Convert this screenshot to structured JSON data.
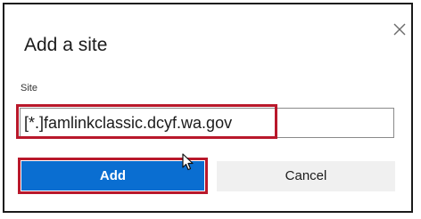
{
  "dialog": {
    "title": "Add a site",
    "close_icon": "close-icon",
    "site_label": "Site",
    "site_value": "[*.]famlinkclassic.dcyf.wa.gov",
    "add_label": "Add",
    "cancel_label": "Cancel",
    "cursor_icon": "mouse-pointer-icon"
  },
  "colors": {
    "primary_button": "#0a6ed1",
    "highlight_outline": "#b9182b",
    "secondary_button": "#f0f0f0"
  }
}
